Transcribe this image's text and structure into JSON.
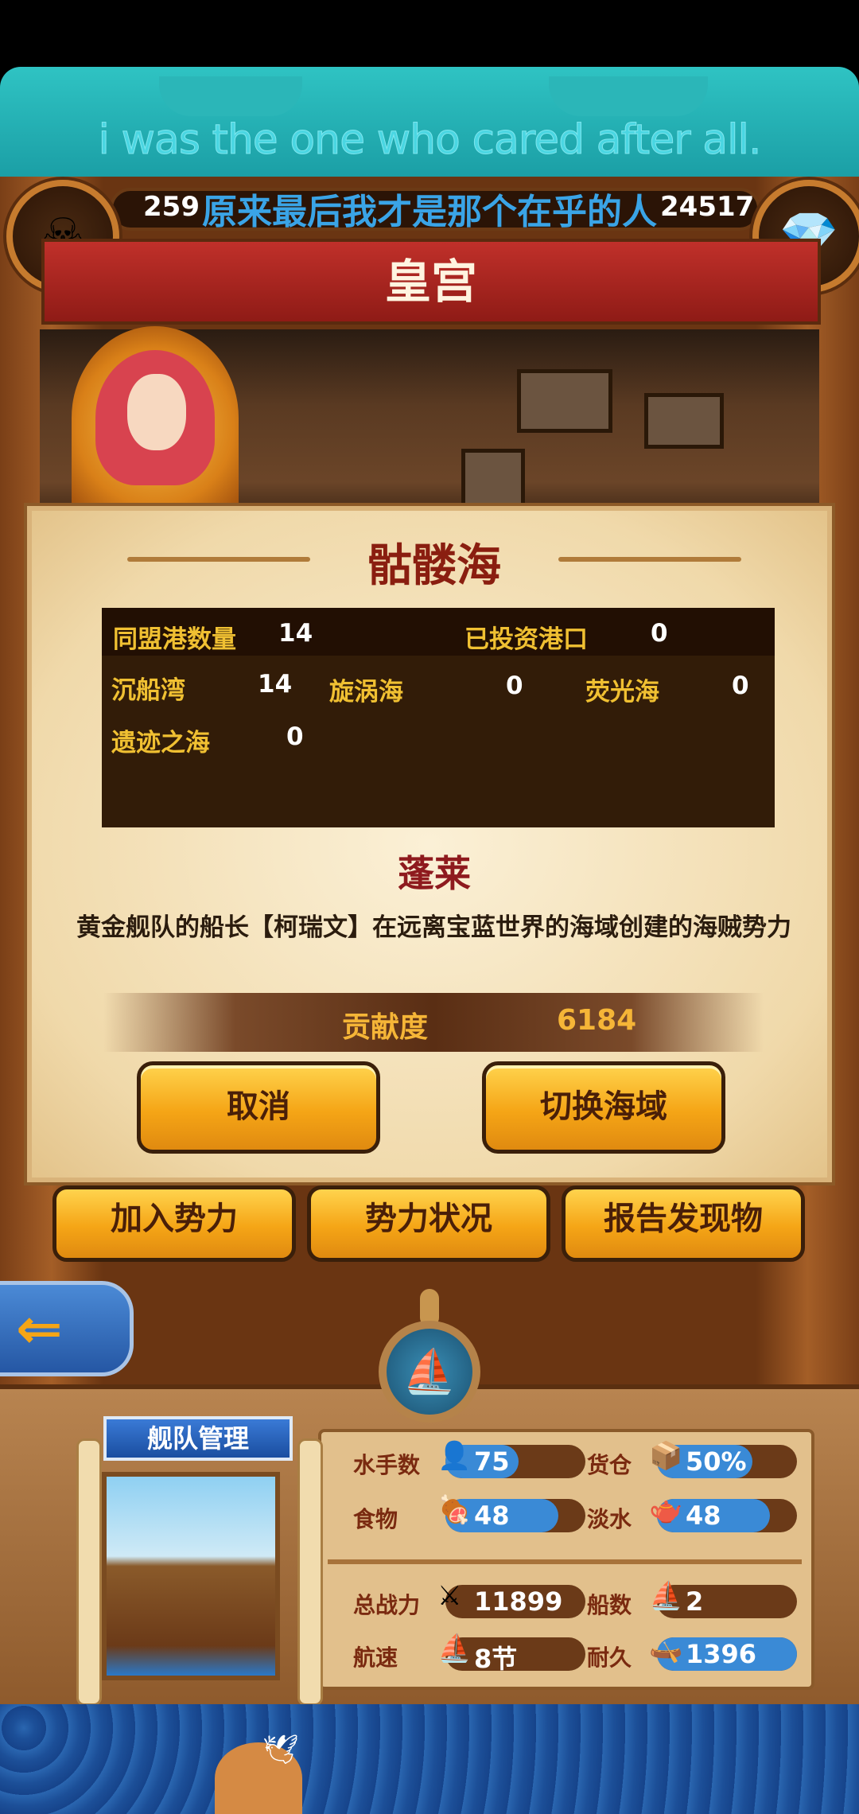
{
  "subtitle": {
    "english": "i was the one who cared after all.",
    "chinese": "原来最后我才是那个在乎的人"
  },
  "resources": {
    "left_value": "259",
    "right_value": "24517"
  },
  "header": {
    "title": "皇宫"
  },
  "dialog": {
    "sea_name": "骷髅海",
    "stats": {
      "allied_ports_label": "同盟港数量",
      "allied_ports_value": "14",
      "invested_ports_label": "已投资港口",
      "invested_ports_value": "0",
      "rows": [
        {
          "label": "沉船湾",
          "value": "14"
        },
        {
          "label": "旋涡海",
          "value": "0"
        },
        {
          "label": "荧光海",
          "value": "0"
        },
        {
          "label": "遗迹之海",
          "value": "0"
        }
      ]
    },
    "faction_name": "蓬莱",
    "faction_desc": "黄金舰队的船长【柯瑞文】在远离宝蓝世界的海域创建的海贼势力",
    "contribution_label": "贡献度",
    "contribution_value": "6184",
    "cancel_label": "取消",
    "switch_label": "切换海域"
  },
  "actions": {
    "join_label": "加入势力",
    "status_label": "势力状况",
    "report_label": "报告发现物"
  },
  "fleet": {
    "title": "舰队管理",
    "sailors_label": "水手数",
    "sailors_value": "75",
    "cargo_label": "货仓",
    "cargo_value": "50%",
    "food_label": "食物",
    "food_value": "48",
    "water_label": "淡水",
    "water_value": "48",
    "power_label": "总战力",
    "power_value": "11899",
    "ships_label": "船数",
    "ships_value": "2",
    "speed_label": "航速",
    "speed_value": "8节",
    "durability_label": "耐久",
    "durability_value": "1396"
  },
  "colors": {
    "accent": "#f5a516",
    "title_red": "#8a1e10",
    "teal": "#2fc3c3"
  },
  "icons": [
    "pirate-avatar-icon",
    "treasure-chest-icon",
    "back-arrow-icon",
    "helm-boat-icon"
  ]
}
